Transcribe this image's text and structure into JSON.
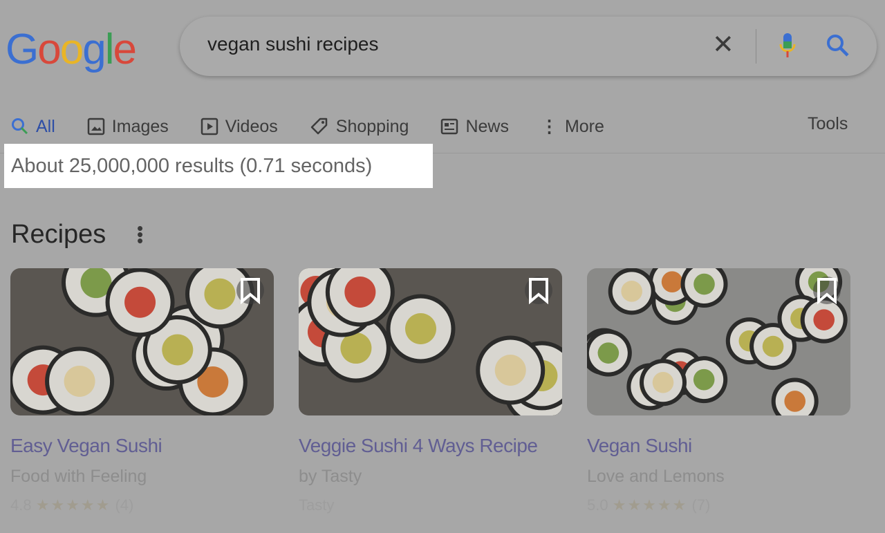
{
  "logo": "Google",
  "search": {
    "query": "vegan sushi recipes",
    "clear_icon": "close-icon",
    "mic_icon": "mic-icon",
    "search_icon": "search-icon"
  },
  "tabs": [
    {
      "label": "All",
      "icon": "search-icon",
      "active": true
    },
    {
      "label": "Images",
      "icon": "image-icon"
    },
    {
      "label": "Videos",
      "icon": "play-icon"
    },
    {
      "label": "Shopping",
      "icon": "tag-icon"
    },
    {
      "label": "News",
      "icon": "newspaper-icon"
    },
    {
      "label": "More",
      "icon": "more-vert-icon"
    }
  ],
  "tools": "Tools",
  "result_stats": "About 25,000,000 results (0.71 seconds)",
  "recipes": {
    "title": "Recipes",
    "cards": [
      {
        "title": "Easy Vegan Sushi",
        "source": "Food with Feeling",
        "rating": "4.8",
        "stars": "★★★★★",
        "reviews": "(4)"
      },
      {
        "title": "Veggie Sushi 4 Ways Recipe",
        "source": "by Tasty",
        "extra": "Tasty"
      },
      {
        "title": "Vegan Sushi",
        "source": "Love and Lemons",
        "rating": "5.0",
        "stars": "★★★★★",
        "reviews": "(7)"
      }
    ]
  },
  "colors": {
    "link": "#615e93",
    "overlay": "#a7a7a7",
    "highlight": "#ffffff"
  }
}
